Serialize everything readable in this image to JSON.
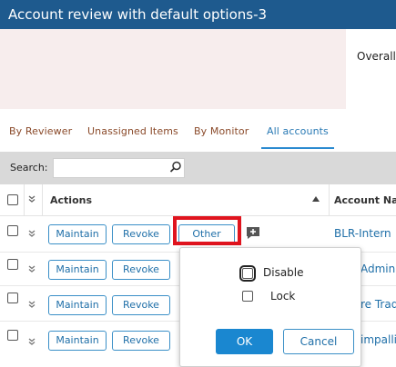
{
  "window": {
    "title": "Account review with default options-3"
  },
  "summary": {
    "overall_label": "Overall"
  },
  "tabs": [
    {
      "label": "By Reviewer",
      "active": false
    },
    {
      "label": "Unassigned Items",
      "active": false
    },
    {
      "label": "By Monitor",
      "active": false
    },
    {
      "label": "All accounts",
      "active": true
    }
  ],
  "toolbar": {
    "search_label": "Search:",
    "search_value": ""
  },
  "table": {
    "headers": {
      "actions": "Actions",
      "account_name": "Account Na"
    },
    "rows": [
      {
        "maintain": "Maintain",
        "revoke": "Revoke",
        "other": "Other",
        "account": "BLR-Intern"
      },
      {
        "maintain": "Maintain",
        "revoke": "Revoke",
        "account": "Admin"
      },
      {
        "maintain": "Maintain",
        "revoke": "Revoke",
        "account": "re Trad"
      },
      {
        "maintain": "Maintain",
        "revoke": "Revoke",
        "account": "impalli"
      }
    ]
  },
  "popup": {
    "options": [
      {
        "label": "Disable",
        "checked": false
      },
      {
        "label": "Lock",
        "checked": false
      }
    ],
    "ok_label": "OK",
    "cancel_label": "Cancel"
  },
  "colors": {
    "titlebar": "#1e5a8e",
    "accent": "#1a87d0",
    "highlight": "#e0141e"
  }
}
